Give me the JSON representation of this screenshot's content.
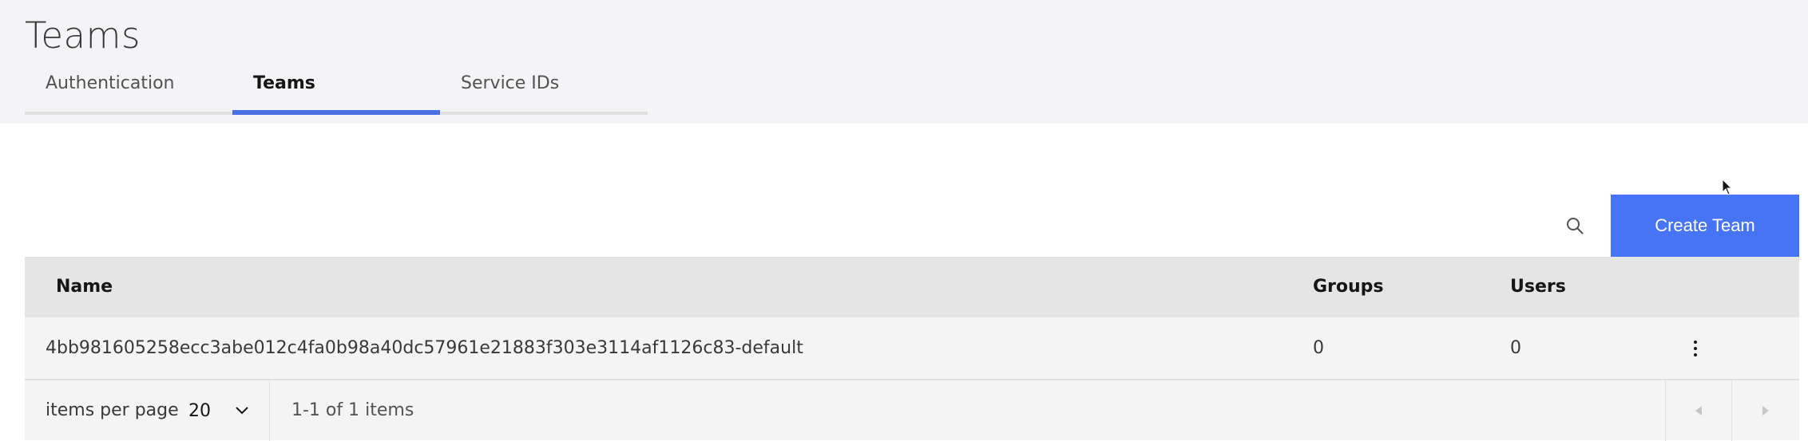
{
  "page": {
    "title": "Teams"
  },
  "tabs": [
    {
      "label": "Authentication",
      "active": false
    },
    {
      "label": "Teams",
      "active": true
    },
    {
      "label": "Service IDs",
      "active": false
    }
  ],
  "toolbar": {
    "search_icon": "search-icon",
    "create_label": "Create Team"
  },
  "table": {
    "columns": [
      "Name",
      "Groups",
      "Users"
    ],
    "rows": [
      {
        "name": "4bb981605258ecc3abe012c4fa0b98a40dc57961e21883f303e3114af1126c83-default",
        "groups": "0",
        "users": "0"
      }
    ]
  },
  "pagination": {
    "items_per_page_label": "items per page",
    "items_per_page_value": "20",
    "range_text": "1-1 of 1 items"
  },
  "colors": {
    "accent": "#4774f5",
    "tab_active_underline": "#4a6ee6",
    "header_bg": "#f4f4f6"
  }
}
